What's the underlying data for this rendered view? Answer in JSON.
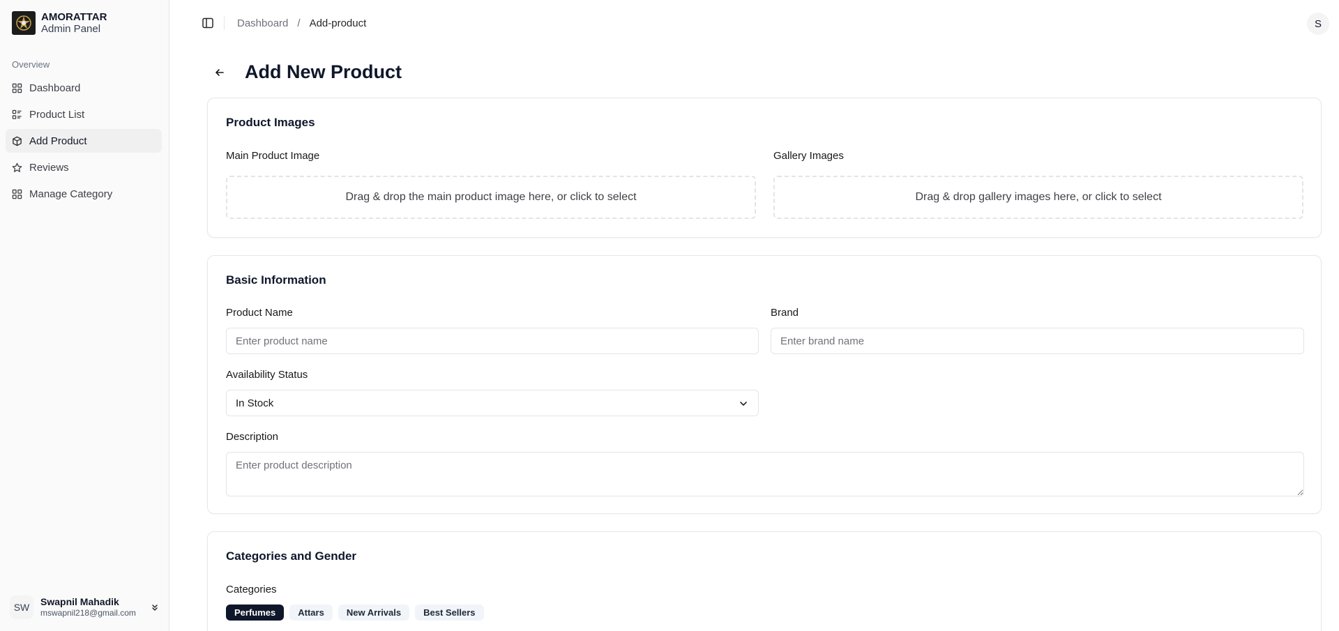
{
  "brand": {
    "name": "AMORATTAR",
    "subtitle": "Admin Panel"
  },
  "sidebar": {
    "group_label": "Overview",
    "items": [
      {
        "label": "Dashboard",
        "icon": "grid-icon",
        "active": false
      },
      {
        "label": "Product List",
        "icon": "list-icon",
        "active": false
      },
      {
        "label": "Add Product",
        "icon": "box-icon",
        "active": true
      },
      {
        "label": "Reviews",
        "icon": "star-icon",
        "active": false
      },
      {
        "label": "Manage Category",
        "icon": "grid-icon",
        "active": false
      }
    ]
  },
  "user": {
    "initials": "SW",
    "name": "Swapnil Mahadik",
    "email": "mswapnil218@gmail.com"
  },
  "header": {
    "breadcrumb": {
      "root": "Dashboard",
      "separator": "/",
      "current": "Add-product"
    },
    "avatar_initial": "S"
  },
  "page": {
    "title": "Add New Product"
  },
  "images_card": {
    "title": "Product Images",
    "main_label": "Main Product Image",
    "main_dropzone": "Drag & drop the main product image here, or click to select",
    "gallery_label": "Gallery Images",
    "gallery_dropzone": "Drag & drop gallery images here, or click to select"
  },
  "basic_card": {
    "title": "Basic Information",
    "name_label": "Product Name",
    "name_placeholder": "Enter product name",
    "brand_label": "Brand",
    "brand_placeholder": "Enter brand name",
    "availability_label": "Availability Status",
    "availability_value": "In Stock",
    "description_label": "Description",
    "description_placeholder": "Enter product description"
  },
  "categories_card": {
    "title": "Categories and Gender",
    "categories_label": "Categories",
    "chips": [
      {
        "label": "Perfumes",
        "selected": true
      },
      {
        "label": "Attars",
        "selected": false
      },
      {
        "label": "New Arrivals",
        "selected": false
      },
      {
        "label": "Best Sellers",
        "selected": false
      }
    ]
  }
}
